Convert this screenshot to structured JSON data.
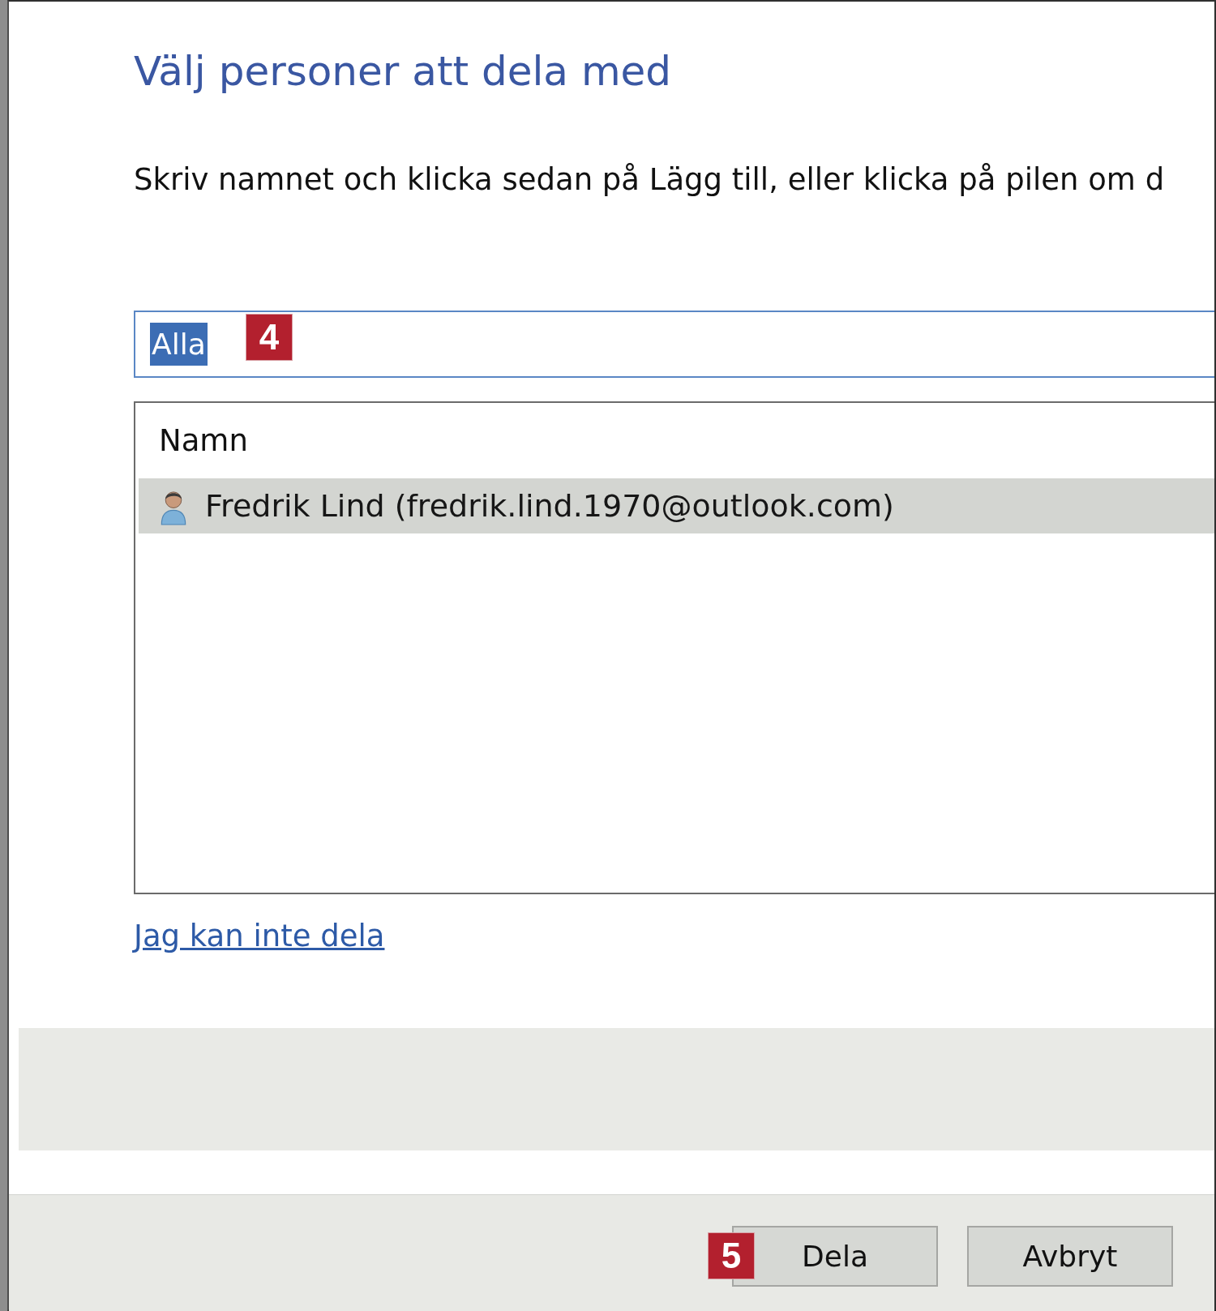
{
  "dialog": {
    "title": "Välj personer att dela med",
    "instruction": "Skriv namnet och klicka sedan på Lägg till, eller klicka på pilen om d"
  },
  "name_field": {
    "value": "Alla",
    "text_selected": true,
    "step_badge": "4"
  },
  "people_list": {
    "columns": [
      "Namn"
    ],
    "rows": [
      {
        "name": "Fredrik Lind (fredrik.lind.1970@outlook.com)",
        "selected": true
      }
    ]
  },
  "link": "Jag kan inte dela",
  "buttons": [
    {
      "label": "Dela",
      "step_badge": "5"
    },
    {
      "label": "Avbryt"
    }
  ]
}
